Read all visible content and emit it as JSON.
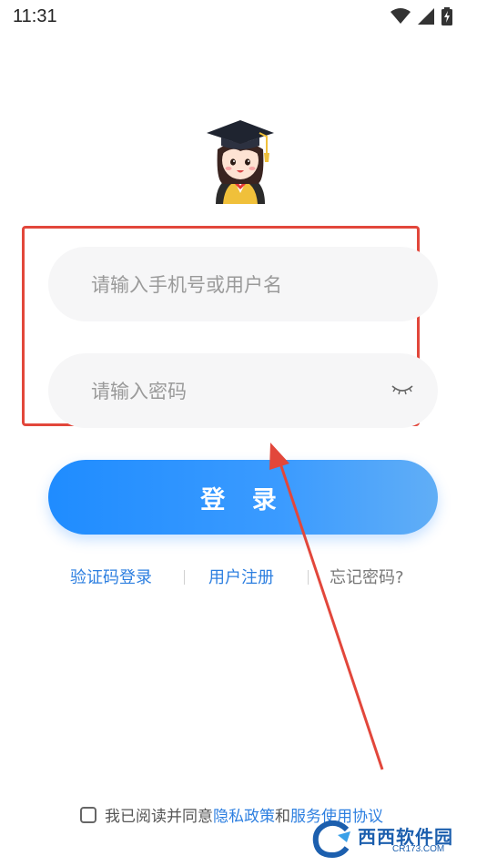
{
  "status_bar": {
    "time": "11:31"
  },
  "login": {
    "username_placeholder": "请输入手机号或用户名",
    "password_placeholder": "请输入密码",
    "login_button": "登 录"
  },
  "links": {
    "sms_login": "验证码登录",
    "register": "用户注册",
    "forgot_password": "忘记密码?"
  },
  "agreement": {
    "prefix": "我已阅读并同意",
    "privacy": "隐私政策",
    "and": "和",
    "terms": "服务使用协议"
  },
  "watermark": {
    "name": "西西软件园",
    "site": "CR173.COM"
  },
  "colors": {
    "accent": "#1f8cff",
    "link": "#2d7fe0",
    "annotation_red": "#e2473b",
    "input_bg": "#f6f6f7"
  },
  "icons": {
    "wifi": "wifi-icon",
    "signal": "signal-icon",
    "battery": "battery-charging-icon",
    "eye": "eye-closed-icon",
    "mascot": "graduate-girl-mascot"
  }
}
